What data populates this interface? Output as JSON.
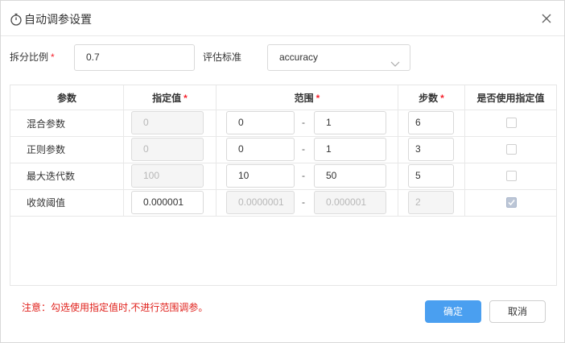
{
  "dialog": {
    "title": "自动调参设置",
    "icon": "stopwatch-icon"
  },
  "form": {
    "split_label": "拆分比例",
    "split_value": "0.7",
    "metric_label": "评估标准",
    "metric_value": "accuracy"
  },
  "table": {
    "headers": {
      "param": "参数",
      "specified": "指定值",
      "range": "范围",
      "steps": "步数",
      "use_specified": "是否使用指定值"
    },
    "rows": [
      {
        "name": "混合参数",
        "specified": "0",
        "range_min": "0",
        "range_max": "1",
        "steps": "6",
        "use_specified": false
      },
      {
        "name": "正则参数",
        "specified": "0",
        "range_min": "0",
        "range_max": "1",
        "steps": "3",
        "use_specified": false
      },
      {
        "name": "最大迭代数",
        "specified": "100",
        "range_min": "10",
        "range_max": "50",
        "steps": "5",
        "use_specified": false
      },
      {
        "name": "收敛阈值",
        "specified": "0.000001",
        "range_min": "0.0000001",
        "range_max": "0.000001",
        "steps": "2",
        "use_specified": true
      }
    ],
    "range_separator": "-"
  },
  "required_mark": "*",
  "note": "注意：勾选使用指定值时,不进行范围调参。",
  "buttons": {
    "confirm": "确定",
    "cancel": "取消"
  },
  "colors": {
    "primary": "#4a9ff0",
    "required": "#f5222d",
    "note": "#e0201b"
  }
}
